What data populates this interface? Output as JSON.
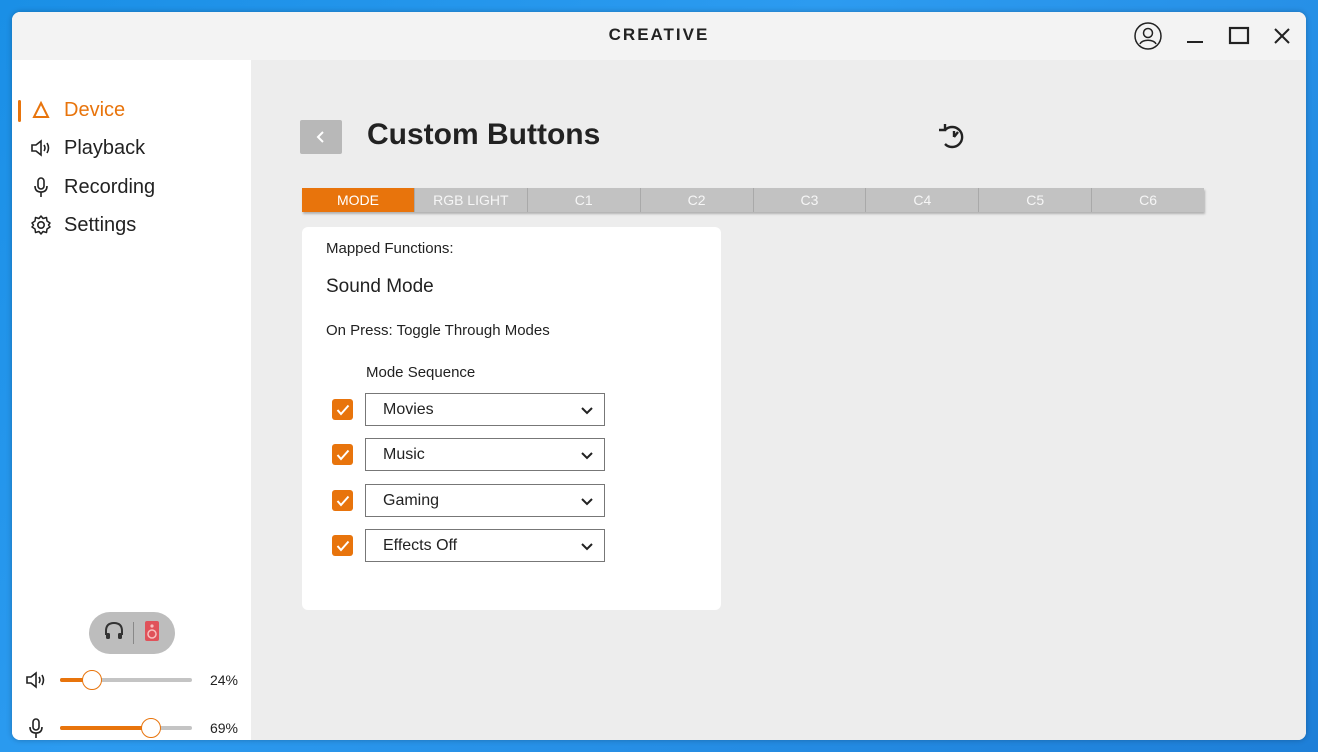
{
  "app": {
    "brand": "CREATIVE"
  },
  "titlebar": {
    "account_icon": "account-icon",
    "minimize_icon": "minimize-icon",
    "maximize_icon": "maximize-icon",
    "close_icon": "close-icon"
  },
  "sidebar": {
    "items": [
      {
        "label": "Device",
        "icon": "device-icon",
        "active": true
      },
      {
        "label": "Playback",
        "icon": "speaker-icon",
        "active": false
      },
      {
        "label": "Recording",
        "icon": "microphone-icon",
        "active": false
      },
      {
        "label": "Settings",
        "icon": "gear-icon",
        "active": false
      }
    ],
    "output_toggle": {
      "left_icon": "headphones-icon",
      "right_icon": "speaker-device-icon"
    },
    "volume": {
      "value_percent": 24,
      "label": "24%"
    },
    "mic": {
      "value_percent": 69,
      "label": "69%"
    }
  },
  "main": {
    "title": "Custom Buttons",
    "tabs": [
      "MODE",
      "RGB LIGHT",
      "C1",
      "C2",
      "C3",
      "C4",
      "C5",
      "C6"
    ],
    "active_tab": "MODE",
    "card": {
      "mapped_label": "Mapped Functions:",
      "function_name": "Sound Mode",
      "on_press": "On Press: Toggle Through Modes",
      "sequence_label": "Mode Sequence",
      "modes": [
        {
          "value": "Movies",
          "checked": true
        },
        {
          "value": "Music",
          "checked": true
        },
        {
          "value": "Gaming",
          "checked": true
        },
        {
          "value": "Effects Off",
          "checked": true
        }
      ]
    }
  },
  "colors": {
    "accent": "#e8740c",
    "tab_bg": "#c2c2c2",
    "background": "#ededed"
  }
}
